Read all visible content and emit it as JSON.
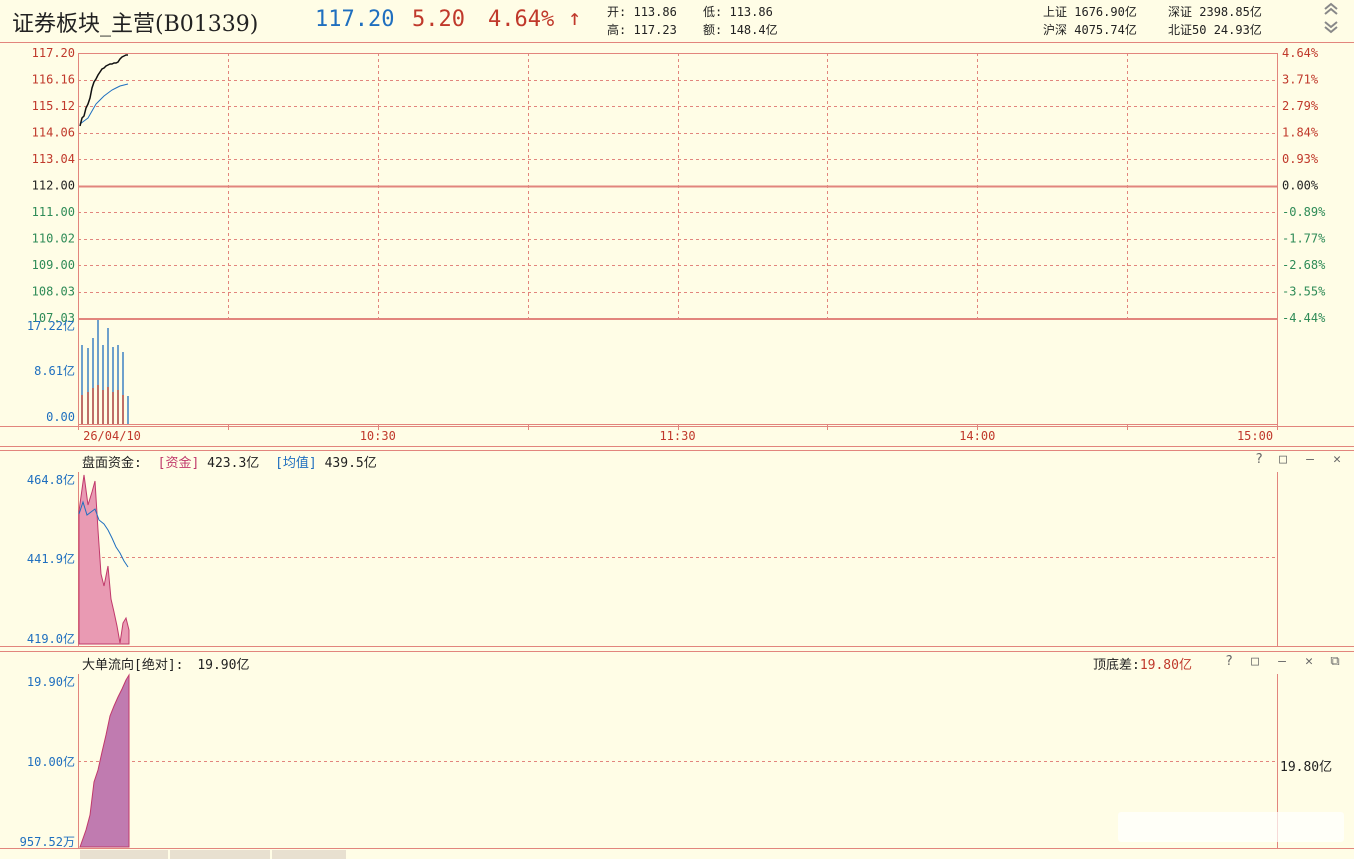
{
  "header": {
    "title": "证券板块_主营(B01339)",
    "price": "117.20",
    "change": "5.20",
    "pct": "4.64%",
    "up_arrow": "↑",
    "open_label": "开:",
    "open_value": "113.86",
    "low_label": "低:",
    "low_value": "113.86",
    "high_label": "高:",
    "high_value": "117.23",
    "amount_label": "额:",
    "amount_value": "148.4亿",
    "indices": [
      {
        "name": "上证",
        "value": "1676.90亿"
      },
      {
        "name": "深证",
        "value": "2398.85亿"
      },
      {
        "name": "沪深",
        "value": "4075.74亿"
      },
      {
        "name": "北证50",
        "value": "24.93亿"
      }
    ]
  },
  "colors": {
    "bg": "#fffde6",
    "grid": "#e2857d",
    "up": "#c0392b",
    "down": "#2e8b57",
    "blue": "#1f6fbf"
  },
  "intraday": {
    "price_ticks": [
      "117.20",
      "116.16",
      "115.12",
      "114.06",
      "113.04",
      "112.00",
      "111.00",
      "110.02",
      "109.00",
      "108.03",
      "107.03"
    ],
    "pct_ticks": [
      "4.64%",
      "3.71%",
      "2.79%",
      "1.84%",
      "0.93%",
      "0.00%",
      "-0.89%",
      "-1.77%",
      "-2.68%",
      "-3.55%",
      "-4.44%"
    ],
    "vol_ticks": [
      "17.22亿",
      "8.61亿",
      "0.00"
    ],
    "time_ticks": [
      "26/04/10",
      "10:30",
      "11:30",
      "14:00",
      "15:00"
    ]
  },
  "panel_capital": {
    "title": "盘面资金:",
    "fund_label": "[资金]",
    "fund_value": "423.3亿",
    "avg_label": "[均值]",
    "avg_value": "439.5亿",
    "ticks": [
      "464.8亿",
      "441.9亿",
      "419.0亿"
    ],
    "buttons": [
      "?",
      "□",
      "—",
      "✕"
    ]
  },
  "panel_bigorder": {
    "title": "大单流向[绝对]:",
    "value": "19.90亿",
    "diff_label": "顶底差:",
    "diff_value": "19.80亿",
    "ticks": [
      "19.90亿",
      "10.00亿",
      "957.52万"
    ],
    "right_label": "19.80亿",
    "buttons": [
      "?",
      "□",
      "—",
      "✕",
      "⧉"
    ]
  }
}
